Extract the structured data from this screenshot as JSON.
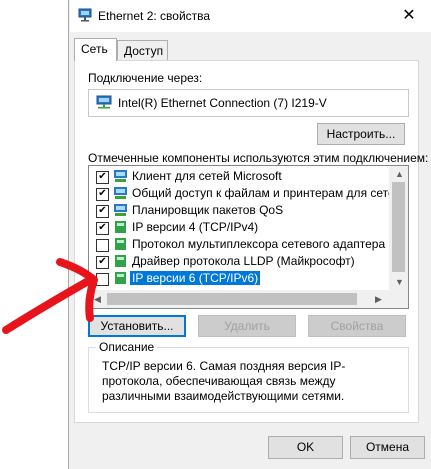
{
  "window": {
    "title": "Ethernet 2: свойства",
    "close_label": "✕"
  },
  "tabs": [
    {
      "label": "Сеть"
    },
    {
      "label": "Доступ"
    }
  ],
  "connect_via_label": "Подключение через:",
  "adapter": {
    "name": "Intel(R) Ethernet Connection (7) I219-V",
    "icon": "network-adapter-icon"
  },
  "configure_button": "Настроить...",
  "components_label": "Отмеченные компоненты используются этим подключением:",
  "components": [
    {
      "checked": true,
      "label": "Клиент для сетей Microsoft",
      "icon": "network-client-icon"
    },
    {
      "checked": true,
      "label": "Общий доступ к файлам и принтерам для сетей Mi",
      "icon": "network-service-icon"
    },
    {
      "checked": true,
      "label": "Планировщик пакетов QoS",
      "icon": "network-service-icon"
    },
    {
      "checked": true,
      "label": "IP версии 4 (TCP/IPv4)",
      "icon": "protocol-icon"
    },
    {
      "checked": false,
      "label": "Протокол мультиплексора сетевого адаптера (Ma",
      "icon": "protocol-icon"
    },
    {
      "checked": true,
      "label": "Драйвер протокола LLDP (Майкрософт)",
      "icon": "protocol-icon"
    },
    {
      "checked": false,
      "label": "IP версии 6 (TCP/IPv6)",
      "icon": "protocol-icon",
      "selected": true
    }
  ],
  "buttons": {
    "install": "Установить...",
    "remove": "Удалить",
    "properties": "Свойства",
    "ok": "OK",
    "cancel": "Отмена"
  },
  "description": {
    "title": "Описание",
    "text": "TCP/IP версии 6. Самая поздняя версия IP-протокола, обеспечивающая связь между различными взаимодействующими сетями."
  },
  "colors": {
    "selection": "#0078d7",
    "annotation": "#e8141b"
  }
}
